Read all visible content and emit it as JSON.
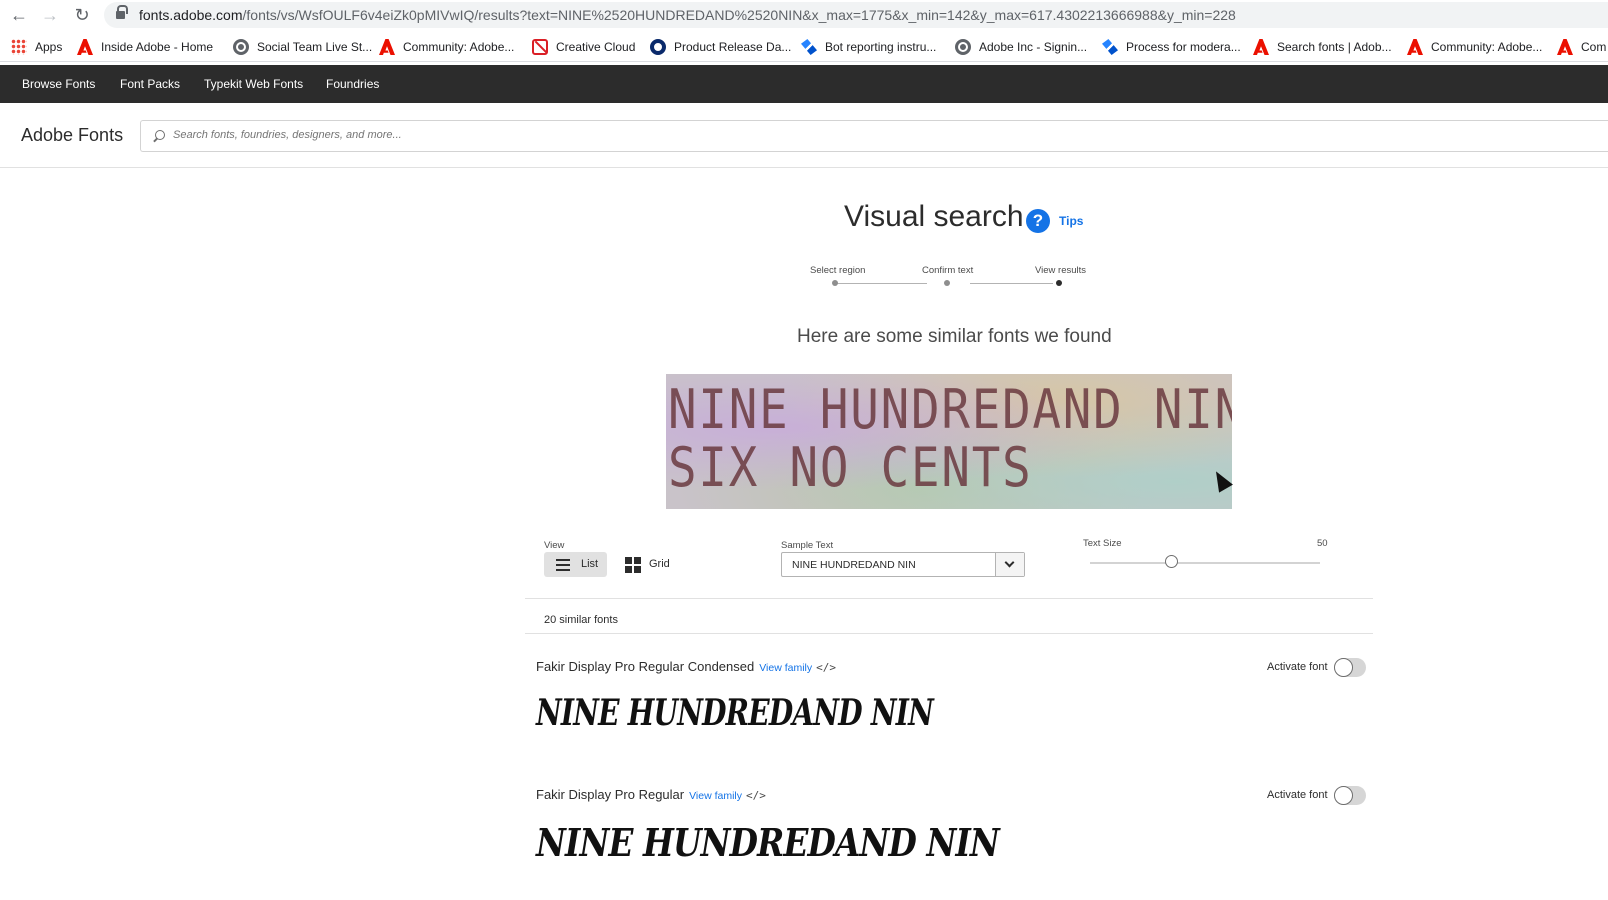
{
  "browser": {
    "url_host": "fonts.adobe.com",
    "url_path": "/fonts/vs/WsfOULF6v4eiZk0pMIVwIQ/results?text=NINE%2520HUNDREDAND%2520NIN&x_max=1775&x_min=142&y_max=617.4302213666988&y_min=228",
    "bookmarks": [
      {
        "label": "Apps",
        "icon": "apps-grid-icon"
      },
      {
        "label": "Inside Adobe - Home",
        "icon": "adobe-icon"
      },
      {
        "label": "Social Team Live St...",
        "icon": "globe-icon"
      },
      {
        "label": "Community: Adobe...",
        "icon": "adobe-icon"
      },
      {
        "label": "Creative Cloud",
        "icon": "creative-cloud-icon"
      },
      {
        "label": "Product Release Da...",
        "icon": "ring-icon"
      },
      {
        "label": "Bot reporting instru...",
        "icon": "confluence-icon"
      },
      {
        "label": "Adobe Inc - Signin...",
        "icon": "globe-icon"
      },
      {
        "label": "Process for modera...",
        "icon": "confluence-icon"
      },
      {
        "label": "Search fonts | Adob...",
        "icon": "adobe-icon"
      },
      {
        "label": "Community: Adobe...",
        "icon": "adobe-icon"
      },
      {
        "label": "Com",
        "icon": "adobe-icon"
      }
    ]
  },
  "nav": {
    "items": [
      "Browse Fonts",
      "Font Packs",
      "Typekit Web Fonts",
      "Foundries"
    ]
  },
  "header": {
    "brand": "Adobe Fonts",
    "search_placeholder": "Search fonts, foundries, designers, and more..."
  },
  "visual_search": {
    "title": "Visual search",
    "tips": "Tips",
    "steps": [
      "Select region",
      "Confirm text",
      "View results"
    ],
    "active_step": 2,
    "results_heading": "Here are some similar fonts we found",
    "sample_image_lines": [
      "NINE HUNDREDAND NIN",
      "SIX NO CENTS"
    ]
  },
  "controls": {
    "view_label": "View",
    "view_list": "List",
    "view_grid": "Grid",
    "view_selected": "List",
    "sample_text_label": "Sample Text",
    "sample_text_value": "NINE HUNDREDAND NIN",
    "text_size_label": "Text Size",
    "text_size_value": "50",
    "text_size_fraction": 0.35
  },
  "results": {
    "count_text": "20 similar fonts",
    "view_family": "View family",
    "code_symbol": "</>",
    "activate_label": "Activate font",
    "fonts": [
      {
        "name": "Fakir Display Pro Regular Condensed",
        "preview": "NINE HUNDREDAND NIN",
        "activated": false
      },
      {
        "name": "Fakir Display Pro Regular",
        "preview": "NINE HUNDREDAND NIN",
        "activated": false
      }
    ]
  },
  "colors": {
    "accent": "#1473e6",
    "nav_bg": "#2c2c2c"
  }
}
